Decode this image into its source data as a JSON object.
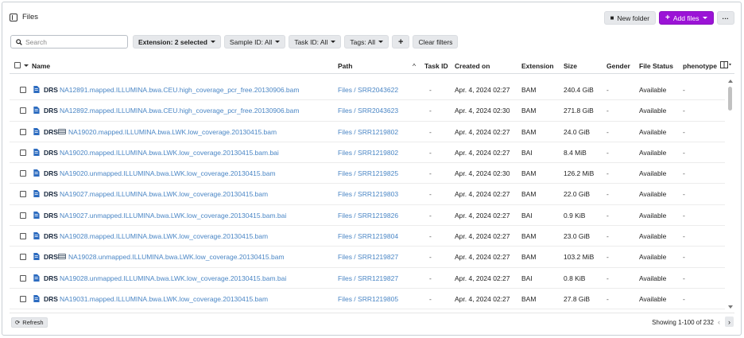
{
  "header": {
    "title": "Files",
    "icon": "sidebar-panel-icon"
  },
  "toolbar": {
    "new_folder": "New folder",
    "add_files": "Add files",
    "more": "···"
  },
  "filters": {
    "search_placeholder": "Search",
    "extension": "Extension: 2 selected",
    "sample_id": "Sample ID: All",
    "task_id": "Task ID: All",
    "tags": "Tags: All",
    "add": "+",
    "clear": "Clear filters"
  },
  "columns": {
    "name": "Name",
    "path": "Path",
    "sort_indicator": "^",
    "task_id": "Task ID",
    "created_on": "Created on",
    "extension": "Extension",
    "size": "Size",
    "gender": "Gender",
    "file_status": "File Status",
    "phenotype": "phenotype"
  },
  "rows": [
    {
      "drs": "DRS",
      "icon": "file-icon",
      "name": "NA12891.mapped.ILLUMINA.bwa.CEU.high_coverage_pcr_free.20130906.bam",
      "path": "Files / SRR2043622",
      "task": "-",
      "created": "Apr. 4, 2024 02:27",
      "ext": "BAM",
      "size": "240.4 GiB",
      "gender": "-",
      "status": "Available",
      "pheno": "-"
    },
    {
      "drs": "DRS",
      "icon": "file-icon",
      "name": "NA12892.mapped.ILLUMINA.bwa.CEU.high_coverage_pcr_free.20130906.bam",
      "path": "Files / SRR2043623",
      "task": "-",
      "created": "Apr. 4, 2024 02:30",
      "ext": "BAM",
      "size": "271.8 GiB",
      "gender": "-",
      "status": "Available",
      "pheno": "-"
    },
    {
      "drs": "DRS",
      "icon": "file-icon",
      "extra": true,
      "name": "NA19020.mapped.ILLUMINA.bwa.LWK.low_coverage.20130415.bam",
      "path": "Files / SRR1219802",
      "task": "-",
      "created": "Apr. 4, 2024 02:27",
      "ext": "BAM",
      "size": "24.0 GiB",
      "gender": "-",
      "status": "Available",
      "pheno": "-"
    },
    {
      "drs": "DRS",
      "icon": "file-icon",
      "name": "NA19020.mapped.ILLUMINA.bwa.LWK.low_coverage.20130415.bam.bai",
      "path": "Files / SRR1219802",
      "task": "-",
      "created": "Apr. 4, 2024 02:27",
      "ext": "BAI",
      "size": "8.4 MiB",
      "gender": "-",
      "status": "Available",
      "pheno": "-"
    },
    {
      "drs": "DRS",
      "icon": "file-icon",
      "name": "NA19020.unmapped.ILLUMINA.bwa.LWK.low_coverage.20130415.bam",
      "path": "Files / SRR1219825",
      "task": "-",
      "created": "Apr. 4, 2024 02:30",
      "ext": "BAM",
      "size": "126.2 MiB",
      "gender": "-",
      "status": "Available",
      "pheno": "-"
    },
    {
      "drs": "DRS",
      "icon": "file-icon",
      "name": "NA19027.mapped.ILLUMINA.bwa.LWK.low_coverage.20130415.bam",
      "path": "Files / SRR1219803",
      "task": "-",
      "created": "Apr. 4, 2024 02:27",
      "ext": "BAM",
      "size": "22.0 GiB",
      "gender": "-",
      "status": "Available",
      "pheno": "-"
    },
    {
      "drs": "DRS",
      "icon": "file-icon",
      "name": "NA19027.unmapped.ILLUMINA.bwa.LWK.low_coverage.20130415.bam.bai",
      "path": "Files / SRR1219826",
      "task": "-",
      "created": "Apr. 4, 2024 02:27",
      "ext": "BAI",
      "size": "0.9 KiB",
      "gender": "-",
      "status": "Available",
      "pheno": "-"
    },
    {
      "drs": "DRS",
      "icon": "file-icon",
      "name": "NA19028.mapped.ILLUMINA.bwa.LWK.low_coverage.20130415.bam",
      "path": "Files / SRR1219804",
      "task": "-",
      "created": "Apr. 4, 2024 02:27",
      "ext": "BAM",
      "size": "23.0 GiB",
      "gender": "-",
      "status": "Available",
      "pheno": "-"
    },
    {
      "drs": "DRS",
      "icon": "file-icon",
      "extra": true,
      "name": "NA19028.unmapped.ILLUMINA.bwa.LWK.low_coverage.20130415.bam",
      "path": "Files / SRR1219827",
      "task": "-",
      "created": "Apr. 4, 2024 02:27",
      "ext": "BAM",
      "size": "103.2 MiB",
      "gender": "-",
      "status": "Available",
      "pheno": "-"
    },
    {
      "drs": "DRS",
      "icon": "file-icon",
      "name": "NA19028.unmapped.ILLUMINA.bwa.LWK.low_coverage.20130415.bam.bai",
      "path": "Files / SRR1219827",
      "task": "-",
      "created": "Apr. 4, 2024 02:27",
      "ext": "BAI",
      "size": "0.8 KiB",
      "gender": "-",
      "status": "Available",
      "pheno": "-"
    },
    {
      "drs": "DRS",
      "icon": "file-icon",
      "name": "NA19031.mapped.ILLUMINA.bwa.LWK.low_coverage.20130415.bam",
      "path": "Files / SRR1219805",
      "task": "-",
      "created": "Apr. 4, 2024 02:27",
      "ext": "BAM",
      "size": "27.8 GiB",
      "gender": "-",
      "status": "Available",
      "pheno": "-"
    }
  ],
  "footer": {
    "refresh": "Refresh",
    "showing": "Showing 1-100 of 232",
    "prev": "‹",
    "next": "›"
  },
  "colors": {
    "accent": "#9b13d6",
    "link": "#4a86c5",
    "file_icon": "#2d6cc0"
  }
}
